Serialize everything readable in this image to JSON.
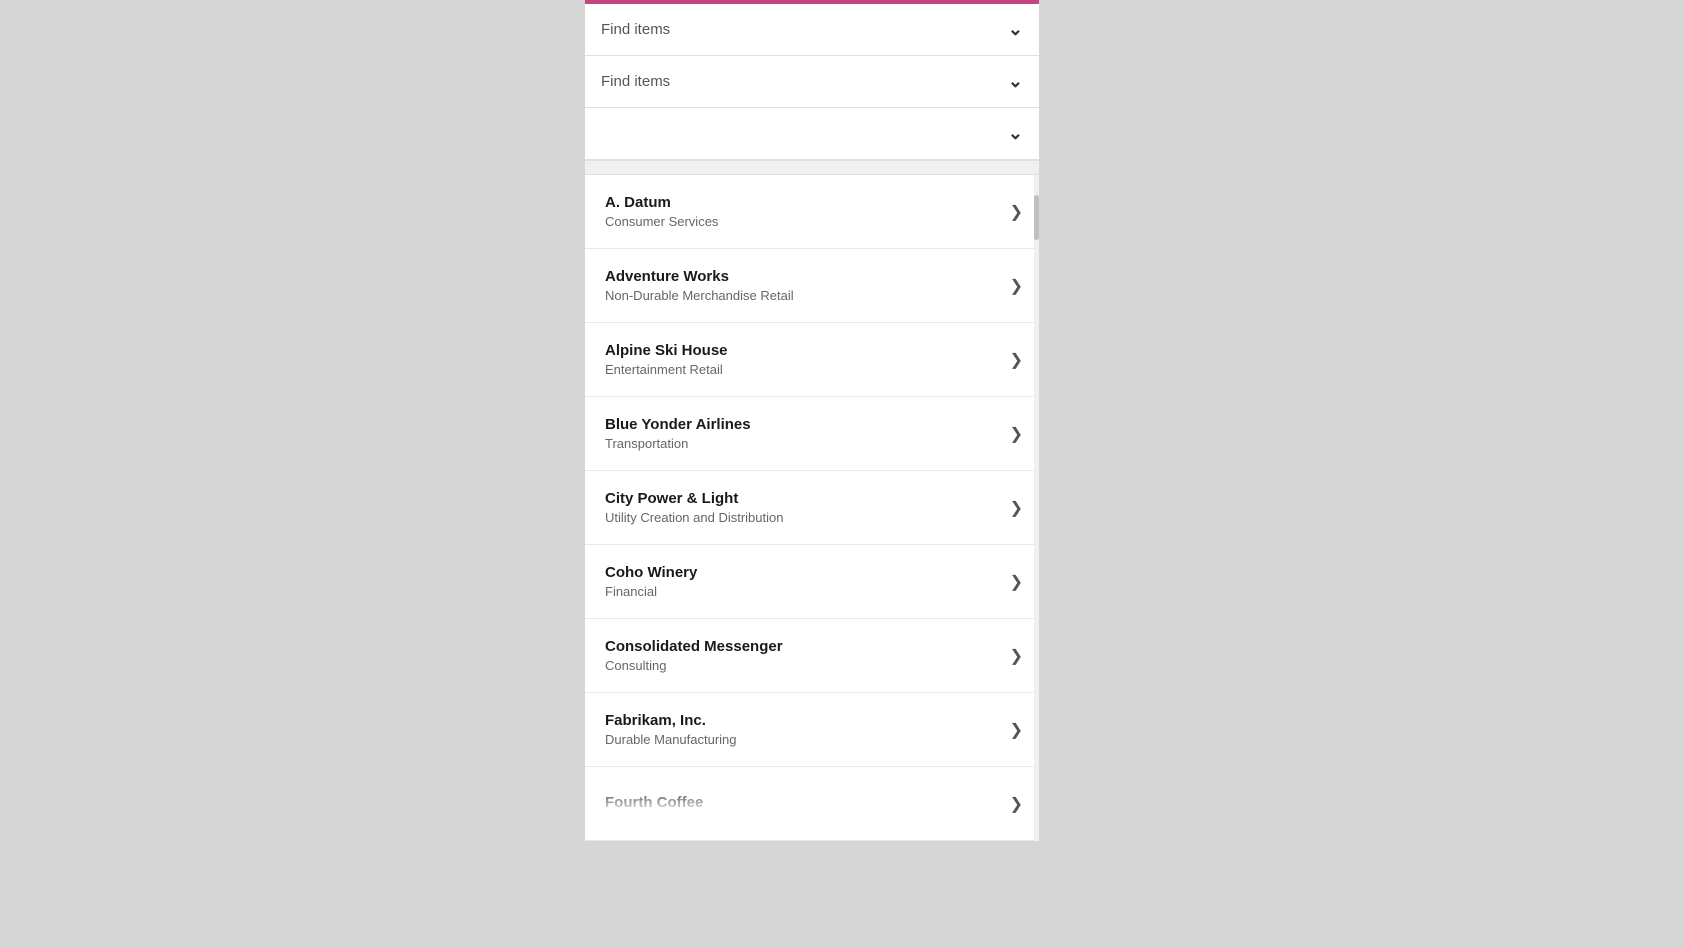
{
  "topbar": {
    "color": "#c44480"
  },
  "filters": [
    {
      "id": "filter1",
      "placeholder": "Find items",
      "chevron": "⌄"
    },
    {
      "id": "filter2",
      "placeholder": "Find items",
      "chevron": "⌄"
    },
    {
      "id": "filter3",
      "placeholder": "",
      "chevron": "⌄"
    }
  ],
  "list_items": [
    {
      "id": "a-datum",
      "title": "A. Datum",
      "subtitle": "Consumer Services"
    },
    {
      "id": "adventure-works",
      "title": "Adventure Works",
      "subtitle": "Non-Durable Merchandise Retail"
    },
    {
      "id": "alpine-ski-house",
      "title": "Alpine Ski House",
      "subtitle": "Entertainment Retail"
    },
    {
      "id": "blue-yonder-airlines",
      "title": "Blue Yonder Airlines",
      "subtitle": "Transportation"
    },
    {
      "id": "city-power-light",
      "title": "City Power & Light",
      "subtitle": "Utility Creation and Distribution"
    },
    {
      "id": "coho-winery",
      "title": "Coho Winery",
      "subtitle": "Financial"
    },
    {
      "id": "consolidated-messenger",
      "title": "Consolidated Messenger",
      "subtitle": "Consulting"
    },
    {
      "id": "fabrikam-inc",
      "title": "Fabrikam, Inc.",
      "subtitle": "Durable Manufacturing"
    },
    {
      "id": "fourth-coffee",
      "title": "Fourth Coffee",
      "subtitle": ""
    }
  ],
  "icons": {
    "chevron_down": "⌄",
    "arrow_right": "❯"
  }
}
